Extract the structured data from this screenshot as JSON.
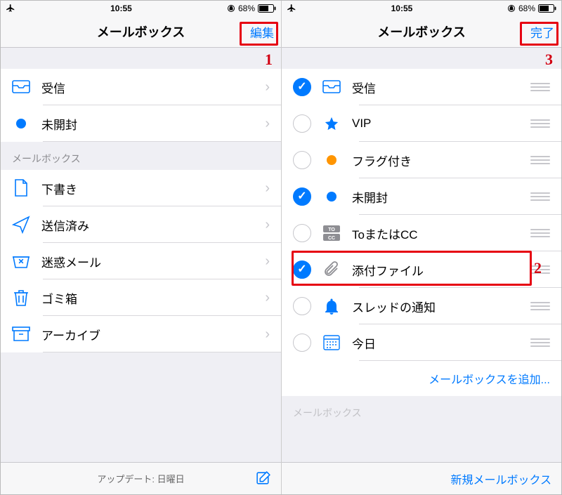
{
  "status": {
    "time": "10:55",
    "battery": "68%"
  },
  "callouts": {
    "one": "1",
    "two": "2",
    "three": "3"
  },
  "left": {
    "title": "メールボックス",
    "action": "編集",
    "smart": [
      {
        "icon": "inbox",
        "label": "受信"
      },
      {
        "icon": "bluedot",
        "label": "未開封"
      }
    ],
    "sectionHeader": "メールボックス",
    "boxes": [
      {
        "icon": "doc",
        "label": "下書き"
      },
      {
        "icon": "send",
        "label": "送信済み"
      },
      {
        "icon": "junk",
        "label": "迷惑メール"
      },
      {
        "icon": "trash",
        "label": "ゴミ箱"
      },
      {
        "icon": "archive",
        "label": "アーカイブ"
      }
    ],
    "toolbar": {
      "status": "アップデート: 日曜日"
    }
  },
  "right": {
    "title": "メールボックス",
    "action": "完了",
    "rows": [
      {
        "checked": true,
        "icon": "inbox",
        "label": "受信"
      },
      {
        "checked": false,
        "icon": "star",
        "label": "VIP"
      },
      {
        "checked": false,
        "icon": "flagdot",
        "label": "フラグ付き"
      },
      {
        "checked": true,
        "icon": "bluedot",
        "label": "未開封"
      },
      {
        "checked": false,
        "icon": "tocc",
        "label": "ToまたはCC"
      },
      {
        "checked": true,
        "icon": "clip",
        "label": "添付ファイル"
      },
      {
        "checked": false,
        "icon": "bell",
        "label": "スレッドの通知"
      },
      {
        "checked": false,
        "icon": "cal",
        "label": "今日"
      }
    ],
    "addLink": "メールボックスを追加...",
    "sectionHeader": "メールボックス",
    "toolbar": {
      "newBox": "新規メールボックス"
    }
  }
}
